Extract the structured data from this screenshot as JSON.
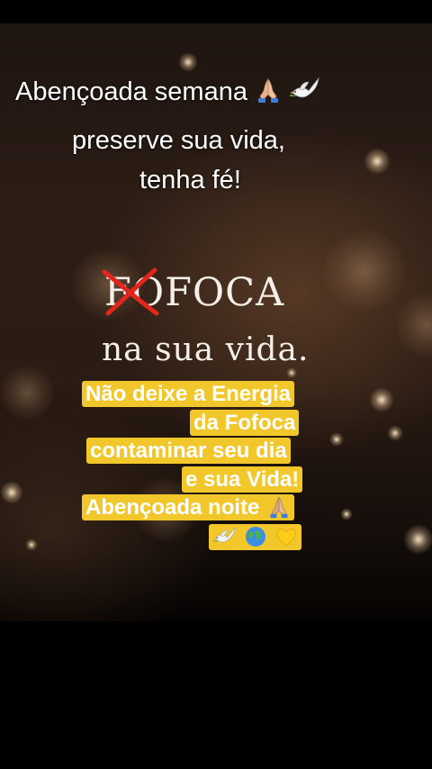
{
  "headline": {
    "line1": "Abençoada semana",
    "line2": "preserve sua vida,",
    "line3": "tenha fé!",
    "line1_icons": [
      "praying-hands",
      "dove"
    ]
  },
  "image_text": {
    "fofoca_first_letter": "F",
    "fofoca_rest": "OFOCA",
    "line2": "na sua vida."
  },
  "caption": {
    "lines": [
      "Não deixe a Energia",
      "da Fofoca",
      "contaminar seu dia",
      "e sua Vida!",
      "Abençoada noite"
    ],
    "line5_icon": "praying-hands",
    "line6_icons": [
      "dove",
      "globe",
      "yellow-heart"
    ]
  },
  "colors": {
    "caption_background": "#f1c72b",
    "strike_mark": "#e3261b",
    "text": "#ffffff"
  }
}
